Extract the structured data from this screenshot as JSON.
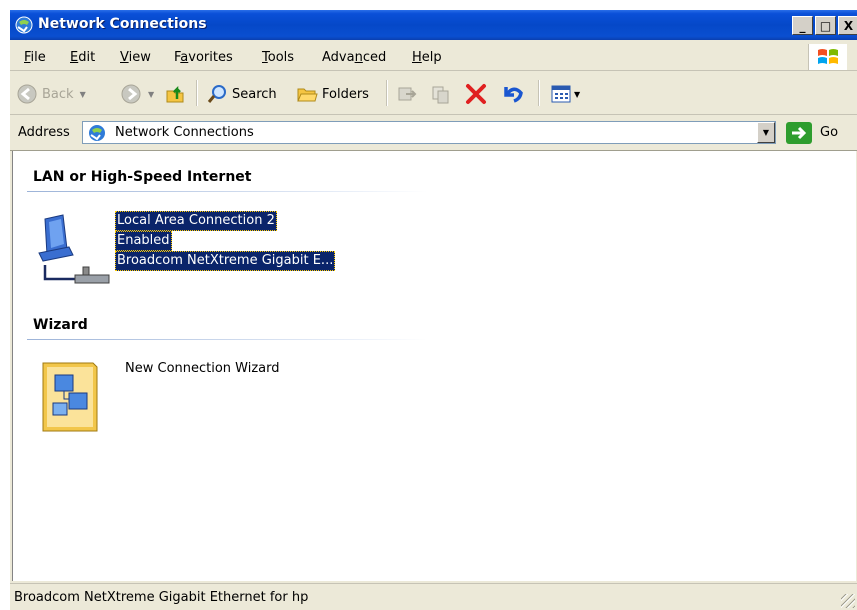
{
  "window": {
    "title": "Network Connections",
    "controls": {
      "minimize": "_",
      "maximize": "□",
      "close": "X"
    }
  },
  "menu": {
    "items": [
      {
        "label": "File",
        "accel": "F"
      },
      {
        "label": "Edit",
        "accel": "E"
      },
      {
        "label": "View",
        "accel": "V"
      },
      {
        "label": "Favorites",
        "accel": "a"
      },
      {
        "label": "Tools",
        "accel": "T"
      },
      {
        "label": "Advanced",
        "accel": "n"
      },
      {
        "label": "Help",
        "accel": "H"
      }
    ]
  },
  "toolbar": {
    "back_label": "Back",
    "search_label": "Search",
    "folders_label": "Folders",
    "icons": [
      "back-icon",
      "forward-icon",
      "up-folder-icon",
      "search-icon",
      "folders-icon",
      "move-to-icon",
      "copy-to-icon",
      "delete-icon",
      "undo-icon",
      "views-icon"
    ]
  },
  "address": {
    "label": "Address",
    "value": "Network Connections",
    "go_label": "Go"
  },
  "groups": {
    "lan": {
      "title": "LAN or High-Speed Internet",
      "item": {
        "name": "Local Area Connection 2",
        "status": "Enabled",
        "device": "Broadcom NetXtreme Gigabit E...",
        "selected": true
      }
    },
    "wizard": {
      "title": "Wizard",
      "item": {
        "name": "New Connection Wizard"
      }
    }
  },
  "statusbar": {
    "text": "Broadcom NetXtreme Gigabit Ethernet for hp"
  },
  "colors": {
    "titlebar": "#0548c8",
    "selection": "#0a246a",
    "chrome": "#ece9d8",
    "delete_red": "#e02020"
  }
}
